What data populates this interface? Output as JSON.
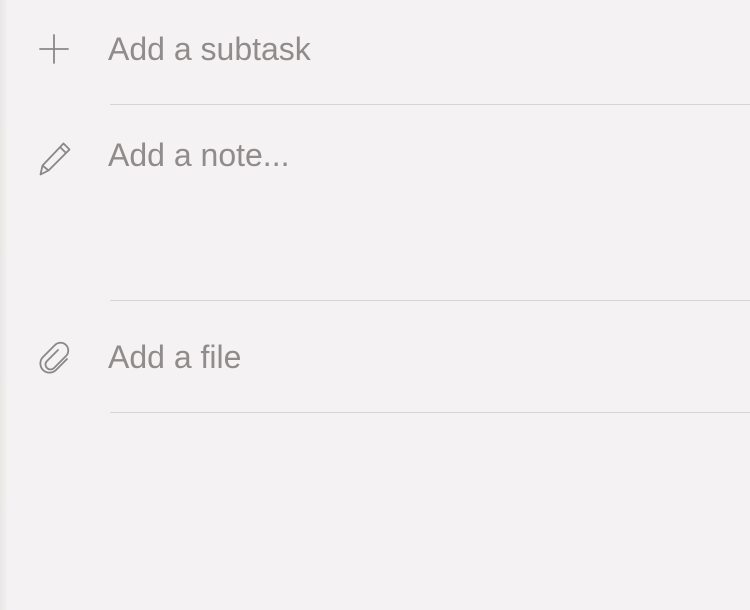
{
  "detail": {
    "subtask": {
      "icon": "plus-icon",
      "placeholder": "Add a subtask"
    },
    "note": {
      "icon": "pencil-icon",
      "placeholder": "Add a note..."
    },
    "file": {
      "icon": "paperclip-icon",
      "placeholder": "Add a file"
    }
  },
  "colors": {
    "background": "#f4f2f2",
    "placeholder_text": "#8f8c8b",
    "icon": "#8a8887",
    "divider": "#d7d5d4"
  }
}
